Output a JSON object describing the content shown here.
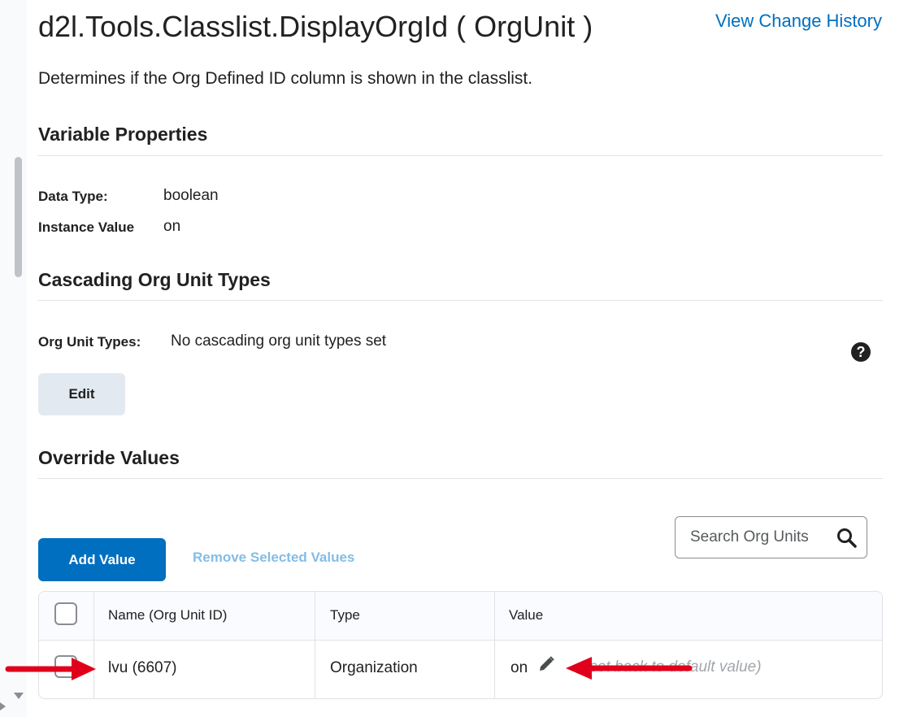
{
  "page": {
    "title": "d2l.Tools.Classlist.DisplayOrgId ( OrgUnit )",
    "history_link": "View Change History",
    "description": "Determines if the Org Defined ID column is shown in the classlist."
  },
  "variable_properties": {
    "heading": "Variable Properties",
    "data_type_label": "Data Type:",
    "data_type_value": "boolean",
    "instance_value_label": "Instance Value",
    "instance_value": "on"
  },
  "cascading": {
    "heading": "Cascading Org Unit Types",
    "org_unit_types_label": "Org Unit Types:",
    "org_unit_types_value": "No cascading org unit types set",
    "help_icon": "question-circle-icon",
    "help_glyph": "?",
    "edit_label": "Edit"
  },
  "overrides": {
    "heading": "Override Values",
    "add_label": "Add Value",
    "remove_label": "Remove Selected Values",
    "search_placeholder": "Search Org Units",
    "columns": [
      "Name (Org Unit ID)",
      "Type",
      "Value"
    ],
    "rows": [
      {
        "name": "lvu (6607)",
        "type": "Organization",
        "value": "on",
        "note": "(set back to default value)"
      }
    ]
  },
  "colors": {
    "link": "#006fbf",
    "primary_button": "#006fbf",
    "disabled_link": "#83bde6",
    "annotation_arrow": "#e0001b"
  }
}
